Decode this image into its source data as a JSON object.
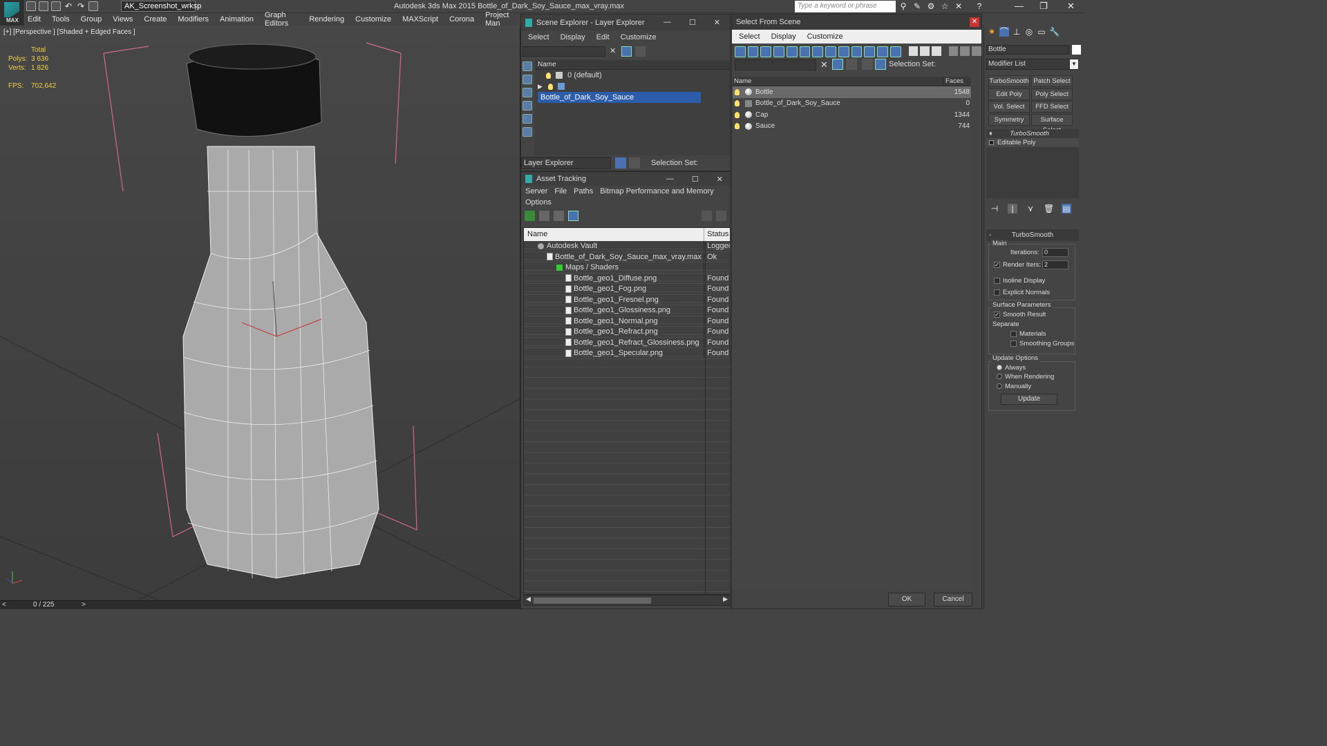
{
  "titlebar": {
    "workspace": "AK_Screenshot_wrksp",
    "app_title": "Autodesk 3ds Max  2015     Bottle_of_Dark_Soy_Sauce_max_vray.max",
    "search_placeholder": "Type a keyword or phrase",
    "logo_label": "MAX"
  },
  "menu": [
    "Edit",
    "Tools",
    "Group",
    "Views",
    "Create",
    "Modifiers",
    "Animation",
    "Graph Editors",
    "Rendering",
    "Customize",
    "MAXScript",
    "Corona",
    "Project Man"
  ],
  "viewport": {
    "label": "[+] [Perspective ] [Shaded + Edged Faces ]",
    "stats": {
      "total_label": "Total",
      "polys_label": "Polys:",
      "polys": "3 636",
      "verts_label": "Verts:",
      "verts": "1 826",
      "fps_label": "FPS:",
      "fps": "702,642"
    },
    "timeline": "0 / 225"
  },
  "scene_explorer": {
    "title": "Scene Explorer - Layer Explorer",
    "menu": [
      "Select",
      "Display",
      "Edit",
      "Customize"
    ],
    "column": "Name",
    "rows": [
      {
        "label": "0 (default)"
      },
      {
        "label": "Bottle_of_Dark_Soy_Sauce"
      }
    ],
    "footer_dropdown": "Layer Explorer",
    "selection_set": "Selection Set:"
  },
  "asset_tracking": {
    "title": "Asset Tracking",
    "menu": [
      "Server",
      "File",
      "Paths",
      "Bitmap Performance and Memory"
    ],
    "menu2": "Options",
    "columns": {
      "name": "Name",
      "status": "Status"
    },
    "rows": [
      {
        "name": "Autodesk Vault",
        "status": "Logged"
      },
      {
        "name": "Bottle_of_Dark_Soy_Sauce_max_vray.max",
        "status": "Ok"
      },
      {
        "name": "Maps / Shaders",
        "status": ""
      },
      {
        "name": "Bottle_geo1_Diffuse.png",
        "status": "Found"
      },
      {
        "name": "Bottle_geo1_Fog.png",
        "status": "Found"
      },
      {
        "name": "Bottle_geo1_Fresnel.png",
        "status": "Found"
      },
      {
        "name": "Bottle_geo1_Glossiness.png",
        "status": "Found"
      },
      {
        "name": "Bottle_geo1_Normal.png",
        "status": "Found"
      },
      {
        "name": "Bottle_geo1_Refract.png",
        "status": "Found"
      },
      {
        "name": "Bottle_geo1_Refract_Glossiness.png",
        "status": "Found"
      },
      {
        "name": "Bottle_geo1_Specular.png",
        "status": "Found"
      }
    ]
  },
  "select_from_scene": {
    "title": "Select From Scene",
    "menu": [
      "Select",
      "Display",
      "Customize"
    ],
    "selection_set": "Selection Set:",
    "columns": {
      "name": "Name",
      "faces": "Faces"
    },
    "rows": [
      {
        "name": "Bottle",
        "faces": "1548"
      },
      {
        "name": "Bottle_of_Dark_Soy_Sauce",
        "faces": "0"
      },
      {
        "name": "Cap",
        "faces": "1344"
      },
      {
        "name": "Sauce",
        "faces": "744"
      }
    ],
    "ok": "OK",
    "cancel": "Cancel"
  },
  "command_panel": {
    "object_name": "Bottle",
    "modifier_list": "Modifier List",
    "buttons": [
      "TurboSmooth",
      "Patch Select",
      "Edit Poly",
      "Poly Select",
      "Vol. Select",
      "FFD Select",
      "Symmetry",
      "Surface Select"
    ],
    "stack": [
      "TurboSmooth",
      "Editable Poly"
    ],
    "rollout_title": "TurboSmooth",
    "main_label": "Main",
    "iterations_label": "Iterations:",
    "iterations": "0",
    "render_iters_label": "Render Iters:",
    "render_iters": "2",
    "isoline": "Isoline Display",
    "explicit": "Explicit Normals",
    "surface_params": "Surface Parameters",
    "smooth_result": "Smooth Result",
    "separate": "Separate",
    "materials": "Materials",
    "smoothing_groups": "Smoothing Groups",
    "update_options": "Update Options",
    "always": "Always",
    "when_rendering": "When Rendering",
    "manually": "Manually",
    "update": "Update"
  }
}
